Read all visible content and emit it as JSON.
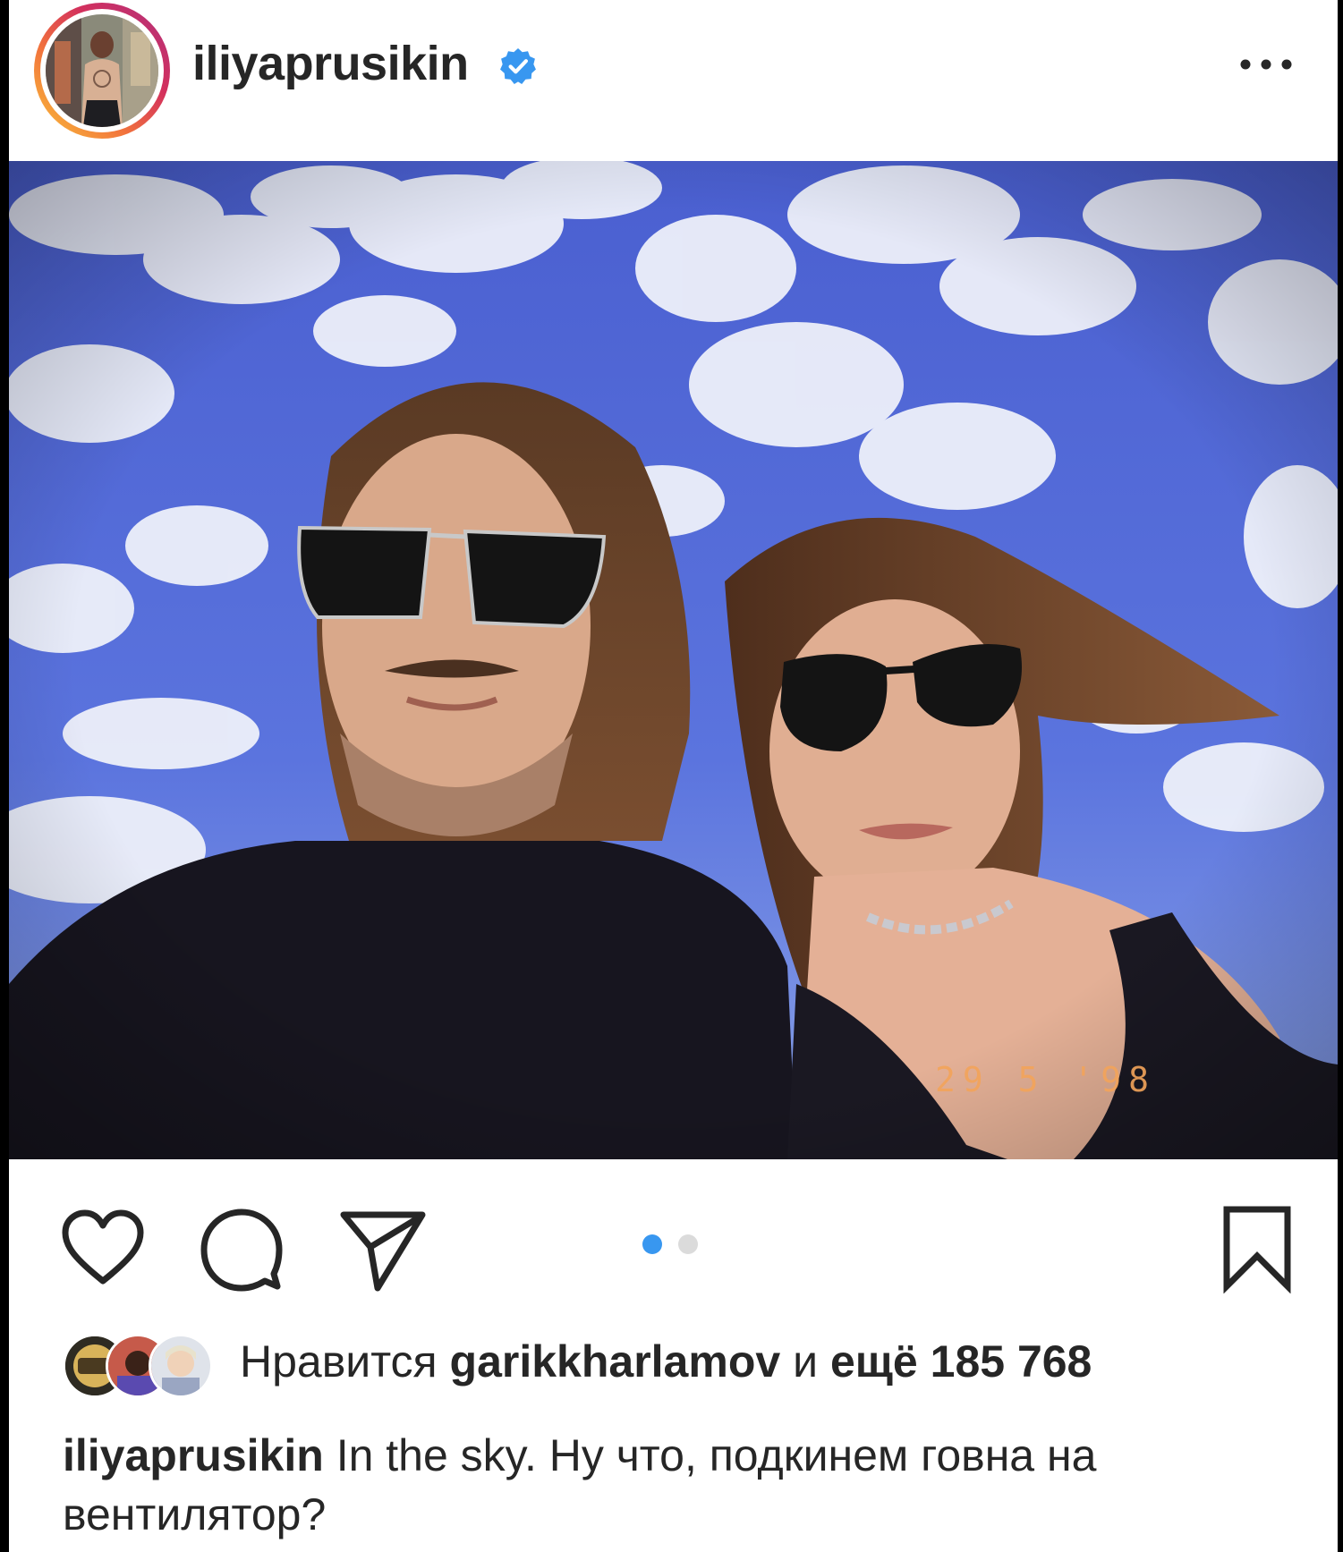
{
  "post": {
    "username": "iliyaprusikin",
    "verified": true,
    "more_icon": "more-horizontal-icon",
    "photo": {
      "description_icon": "photo",
      "date_stamp": "29 5 '98"
    },
    "carousel": {
      "total": 2,
      "active_index": 0,
      "active_color": "#3897f0",
      "inactive_color": "#dbdbdb"
    },
    "actions": {
      "like_icon": "heart-icon",
      "comment_icon": "comment-icon",
      "share_icon": "send-icon",
      "save_icon": "bookmark-icon"
    },
    "likes": {
      "prefix": "Нравится",
      "liker": "garikkharlamov",
      "conjunction": "и",
      "rest": "ещё 185 768"
    },
    "caption": {
      "author": "iliyaprusikin",
      "text": "In the sky. Ну что, подкинем говна на вентилятор?"
    },
    "colors": {
      "text": "#262626",
      "verified_badge": "#3897f0"
    }
  }
}
